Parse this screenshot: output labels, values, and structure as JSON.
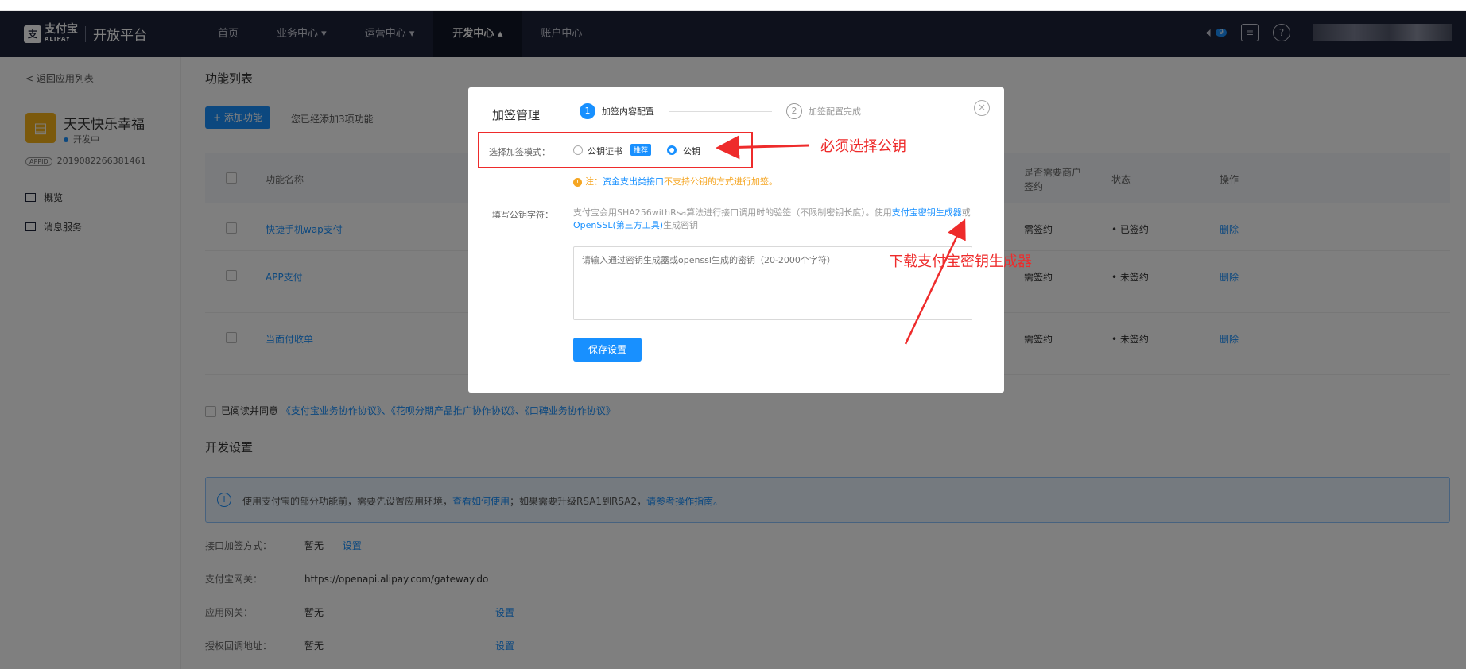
{
  "nav": {
    "logo_mark": "支",
    "logo_zh": "支付宝",
    "logo_en": "ALIPAY",
    "title": "开放平台",
    "items": [
      {
        "label": "首页"
      },
      {
        "label": "业务中心 ▾"
      },
      {
        "label": "运营中心 ▾"
      },
      {
        "label": "开发中心 ▴"
      },
      {
        "label": "账户中心"
      }
    ],
    "notify_count": "9"
  },
  "sidebar": {
    "back": "< 返回应用列表",
    "app_name": "天天快乐幸福",
    "app_status": "开发中",
    "app_tag": "APPID",
    "app_id": "2019082266381461",
    "menu": [
      {
        "label": "概览"
      },
      {
        "label": "消息服务"
      }
    ]
  },
  "main": {
    "title": "功能列表",
    "add_button": "+ 添加功能",
    "added_count": "您已经添加3项功能",
    "columns": {
      "name": "功能名称",
      "sign_req": "是否需要商户签约",
      "status": "状态",
      "action": "操作"
    },
    "rows": [
      {
        "name": "快捷手机wap支付",
        "sign": "需签约",
        "status": "• 已签约",
        "action": "删除"
      },
      {
        "name": "APP支付",
        "sign": "需签约",
        "status": "• 未签约",
        "action": "删除"
      },
      {
        "name": "当面付收单",
        "sign": "需签约",
        "status": "• 未签约",
        "action": "删除"
      }
    ],
    "agree_text": "已阅读并同意",
    "agree_links": "《支付宝业务协作协议》、《花呗分期产品推广协作协议》、《口碑业务协作协议》",
    "dev_title": "开发设置",
    "info_text": "使用支付宝的部分功能前，需要先设置应用环境，",
    "info_link1": "查看如何使用",
    "info_mid": "；如果需要升级RSA1到RSA2，",
    "info_link2": "请参考操作指南。",
    "settings": [
      {
        "key": "接口加签方式：",
        "value": "暂无",
        "link": "设置"
      },
      {
        "key": "支付宝网关：",
        "value": "https://openapi.alipay.com/gateway.do",
        "link": ""
      },
      {
        "key": "应用网关：",
        "value": "暂无",
        "link": "设置"
      },
      {
        "key": "授权回调地址：",
        "value": "暂无",
        "link": "设置"
      }
    ]
  },
  "modal": {
    "title": "加签管理",
    "step1": "加签内容配置",
    "step2": "加签配置完成",
    "close": "×",
    "mode_label": "选择加签模式：",
    "option_cert": "公钥证书",
    "recommend": "推荐",
    "option_key": "公钥",
    "note_prefix": "注：",
    "note_blue": "资金支出类接口",
    "note_rest": "不支持公钥的方式进行加签。",
    "key_label": "填写公钥字符：",
    "key_desc": "支付宝会用SHA256withRsa算法进行接口调用时的验签（不限制密钥长度）。使用",
    "key_desc_link1": "支付宝密钥生成器",
    "key_desc_or": "或",
    "key_desc_link2": "OpenSSL(第三方工具)",
    "key_desc_end": "生成密钥",
    "key_placeholder": "请输入通过密钥生成器或openssl生成的密钥（20-2000个字符）",
    "save": "保存设置"
  },
  "annotations": {
    "must_select": "必须选择公钥",
    "download": "下载支付宝密钥生成器",
    "color": "#ee2b2b"
  }
}
